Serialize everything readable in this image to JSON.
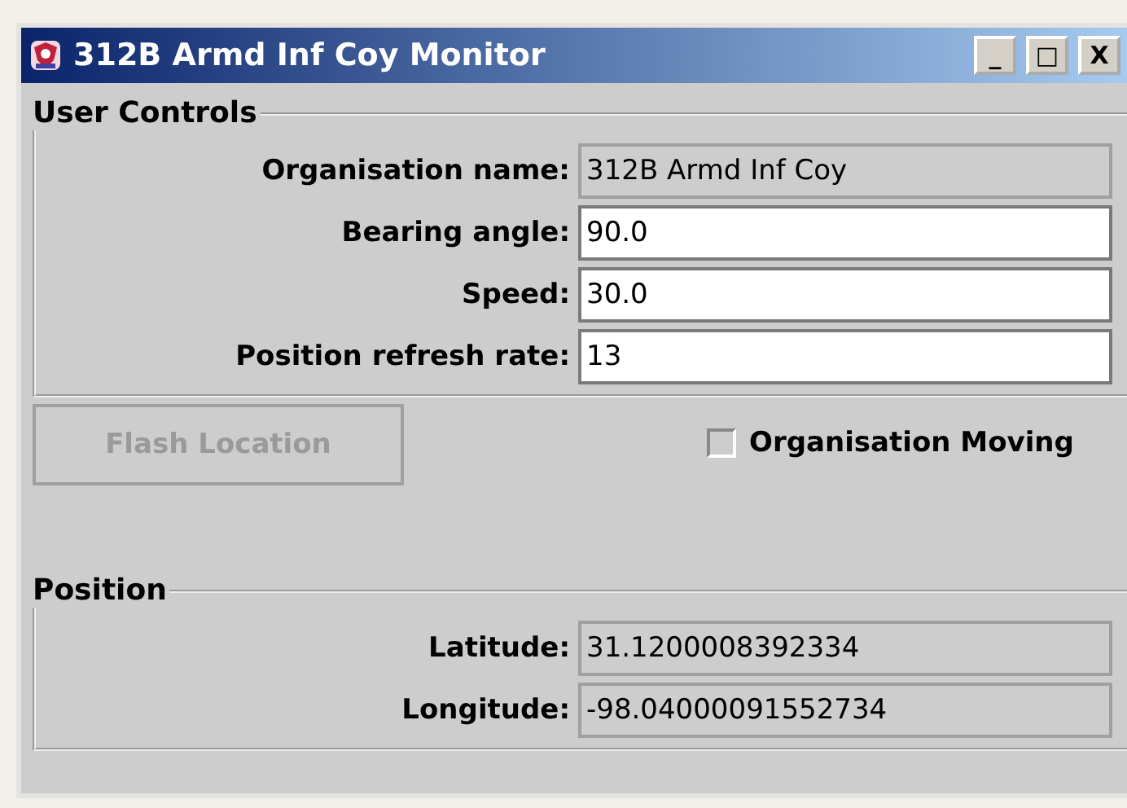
{
  "window": {
    "title": "312B Armd Inf Coy Monitor",
    "buttons": [
      "_",
      "□",
      "X"
    ]
  },
  "user_controls": {
    "title": "User Controls",
    "fields": [
      {
        "label": "Organisation name:",
        "value": "312B Armd Inf Coy",
        "editable": false
      },
      {
        "label": "Bearing angle:",
        "value": "90.0",
        "editable": true
      },
      {
        "label": "Speed:",
        "value": "30.0",
        "editable": true
      },
      {
        "label": "Position refresh rate:",
        "value": "13",
        "editable": true
      }
    ]
  },
  "flash_button": {
    "label": "Flash Location",
    "disabled": true
  },
  "moving_checkbox": {
    "label": "Organisation Moving",
    "checked": false
  },
  "position": {
    "title": "Position",
    "fields": [
      {
        "label": "Latitude:",
        "value": "31.1200008392334",
        "editable": false
      },
      {
        "label": "Longitude:",
        "value": "-98.04000091552734",
        "editable": false
      }
    ]
  }
}
